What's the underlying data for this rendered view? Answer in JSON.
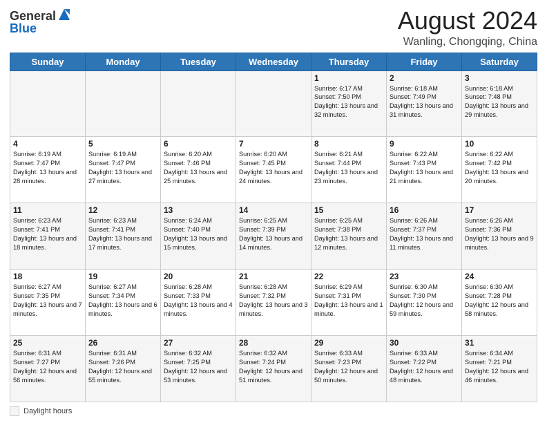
{
  "header": {
    "logo_general": "General",
    "logo_blue": "Blue",
    "main_title": "August 2024",
    "subtitle": "Wanling, Chongqing, China"
  },
  "calendar": {
    "days_of_week": [
      "Sunday",
      "Monday",
      "Tuesday",
      "Wednesday",
      "Thursday",
      "Friday",
      "Saturday"
    ],
    "weeks": [
      [
        {
          "day": "",
          "info": ""
        },
        {
          "day": "",
          "info": ""
        },
        {
          "day": "",
          "info": ""
        },
        {
          "day": "",
          "info": ""
        },
        {
          "day": "1",
          "info": "Sunrise: 6:17 AM\nSunset: 7:50 PM\nDaylight: 13 hours and 32 minutes."
        },
        {
          "day": "2",
          "info": "Sunrise: 6:18 AM\nSunset: 7:49 PM\nDaylight: 13 hours and 31 minutes."
        },
        {
          "day": "3",
          "info": "Sunrise: 6:18 AM\nSunset: 7:48 PM\nDaylight: 13 hours and 29 minutes."
        }
      ],
      [
        {
          "day": "4",
          "info": "Sunrise: 6:19 AM\nSunset: 7:47 PM\nDaylight: 13 hours and 28 minutes."
        },
        {
          "day": "5",
          "info": "Sunrise: 6:19 AM\nSunset: 7:47 PM\nDaylight: 13 hours and 27 minutes."
        },
        {
          "day": "6",
          "info": "Sunrise: 6:20 AM\nSunset: 7:46 PM\nDaylight: 13 hours and 25 minutes."
        },
        {
          "day": "7",
          "info": "Sunrise: 6:20 AM\nSunset: 7:45 PM\nDaylight: 13 hours and 24 minutes."
        },
        {
          "day": "8",
          "info": "Sunrise: 6:21 AM\nSunset: 7:44 PM\nDaylight: 13 hours and 23 minutes."
        },
        {
          "day": "9",
          "info": "Sunrise: 6:22 AM\nSunset: 7:43 PM\nDaylight: 13 hours and 21 minutes."
        },
        {
          "day": "10",
          "info": "Sunrise: 6:22 AM\nSunset: 7:42 PM\nDaylight: 13 hours and 20 minutes."
        }
      ],
      [
        {
          "day": "11",
          "info": "Sunrise: 6:23 AM\nSunset: 7:41 PM\nDaylight: 13 hours and 18 minutes."
        },
        {
          "day": "12",
          "info": "Sunrise: 6:23 AM\nSunset: 7:41 PM\nDaylight: 13 hours and 17 minutes."
        },
        {
          "day": "13",
          "info": "Sunrise: 6:24 AM\nSunset: 7:40 PM\nDaylight: 13 hours and 15 minutes."
        },
        {
          "day": "14",
          "info": "Sunrise: 6:25 AM\nSunset: 7:39 PM\nDaylight: 13 hours and 14 minutes."
        },
        {
          "day": "15",
          "info": "Sunrise: 6:25 AM\nSunset: 7:38 PM\nDaylight: 13 hours and 12 minutes."
        },
        {
          "day": "16",
          "info": "Sunrise: 6:26 AM\nSunset: 7:37 PM\nDaylight: 13 hours and 11 minutes."
        },
        {
          "day": "17",
          "info": "Sunrise: 6:26 AM\nSunset: 7:36 PM\nDaylight: 13 hours and 9 minutes."
        }
      ],
      [
        {
          "day": "18",
          "info": "Sunrise: 6:27 AM\nSunset: 7:35 PM\nDaylight: 13 hours and 7 minutes."
        },
        {
          "day": "19",
          "info": "Sunrise: 6:27 AM\nSunset: 7:34 PM\nDaylight: 13 hours and 6 minutes."
        },
        {
          "day": "20",
          "info": "Sunrise: 6:28 AM\nSunset: 7:33 PM\nDaylight: 13 hours and 4 minutes."
        },
        {
          "day": "21",
          "info": "Sunrise: 6:28 AM\nSunset: 7:32 PM\nDaylight: 13 hours and 3 minutes."
        },
        {
          "day": "22",
          "info": "Sunrise: 6:29 AM\nSunset: 7:31 PM\nDaylight: 13 hours and 1 minute."
        },
        {
          "day": "23",
          "info": "Sunrise: 6:30 AM\nSunset: 7:30 PM\nDaylight: 12 hours and 59 minutes."
        },
        {
          "day": "24",
          "info": "Sunrise: 6:30 AM\nSunset: 7:28 PM\nDaylight: 12 hours and 58 minutes."
        }
      ],
      [
        {
          "day": "25",
          "info": "Sunrise: 6:31 AM\nSunset: 7:27 PM\nDaylight: 12 hours and 56 minutes."
        },
        {
          "day": "26",
          "info": "Sunrise: 6:31 AM\nSunset: 7:26 PM\nDaylight: 12 hours and 55 minutes."
        },
        {
          "day": "27",
          "info": "Sunrise: 6:32 AM\nSunset: 7:25 PM\nDaylight: 12 hours and 53 minutes."
        },
        {
          "day": "28",
          "info": "Sunrise: 6:32 AM\nSunset: 7:24 PM\nDaylight: 12 hours and 51 minutes."
        },
        {
          "day": "29",
          "info": "Sunrise: 6:33 AM\nSunset: 7:23 PM\nDaylight: 12 hours and 50 minutes."
        },
        {
          "day": "30",
          "info": "Sunrise: 6:33 AM\nSunset: 7:22 PM\nDaylight: 12 hours and 48 minutes."
        },
        {
          "day": "31",
          "info": "Sunrise: 6:34 AM\nSunset: 7:21 PM\nDaylight: 12 hours and 46 minutes."
        }
      ]
    ]
  },
  "legend": {
    "label": "Daylight hours"
  }
}
